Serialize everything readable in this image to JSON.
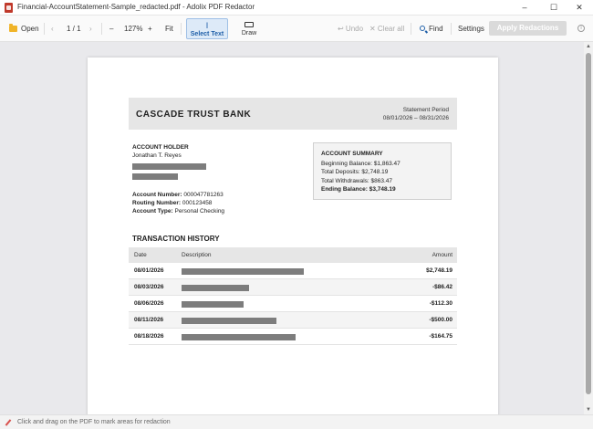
{
  "window": {
    "title": "Financial-AccountStatement-Sample_redacted.pdf - Adolix PDF Redactor",
    "minimize": "–",
    "maximize": "☐",
    "close": "✕"
  },
  "toolbar": {
    "open_label": "Open",
    "prev_page": "‹",
    "page_indicator": "1 / 1",
    "next_page": "›",
    "zoom_out": "–",
    "zoom_level": "127%",
    "zoom_in": "+",
    "fit_label": "Fit",
    "select_text_label": "Select Text",
    "select_text_icon": "I",
    "draw_label": "Draw",
    "undo_label": "↩ Undo",
    "clear_all_label": "✕ Clear all",
    "find_label": "Find",
    "settings_label": "Settings",
    "apply_label": "Apply Redactions",
    "info_icon": "i"
  },
  "document": {
    "bank_name": "CASCADE TRUST BANK",
    "period_label": "Statement Period",
    "period_value": "08/01/2026 – 08/31/2026",
    "holder_heading": "ACCOUNT HOLDER",
    "holder_name": "Jonathan T. Reyes",
    "account_number_label": "Account Number:",
    "account_number": "000047781263",
    "routing_number_label": "Routing Number:",
    "routing_number": "000123458",
    "account_type_label": "Account Type:",
    "account_type": "Personal Checking",
    "summary": {
      "heading": "ACCOUNT SUMMARY",
      "beginning": "Beginning Balance:  $1,863.47",
      "deposits": "Total Deposits:  $2,748.19",
      "withdrawals": "Total Withdrawals:  $863.47",
      "ending": "Ending Balance: $3,748.19"
    },
    "transactions_heading": "TRANSACTION HISTORY",
    "columns": {
      "date": "Date",
      "description": "Description",
      "amount": "Amount"
    },
    "transactions": [
      {
        "date": "08/01/2026",
        "amount": "$2,748.19"
      },
      {
        "date": "08/03/2026",
        "amount": "-$86.42"
      },
      {
        "date": "08/06/2026",
        "amount": "-$112.30"
      },
      {
        "date": "08/11/2026",
        "amount": "-$500.00"
      },
      {
        "date": "08/18/2026",
        "amount": "-$164.75"
      }
    ]
  },
  "status": {
    "hint": "Click and drag on the PDF to mark areas for redaction"
  },
  "scrollbar": {
    "up": "▲",
    "down": "▼"
  }
}
